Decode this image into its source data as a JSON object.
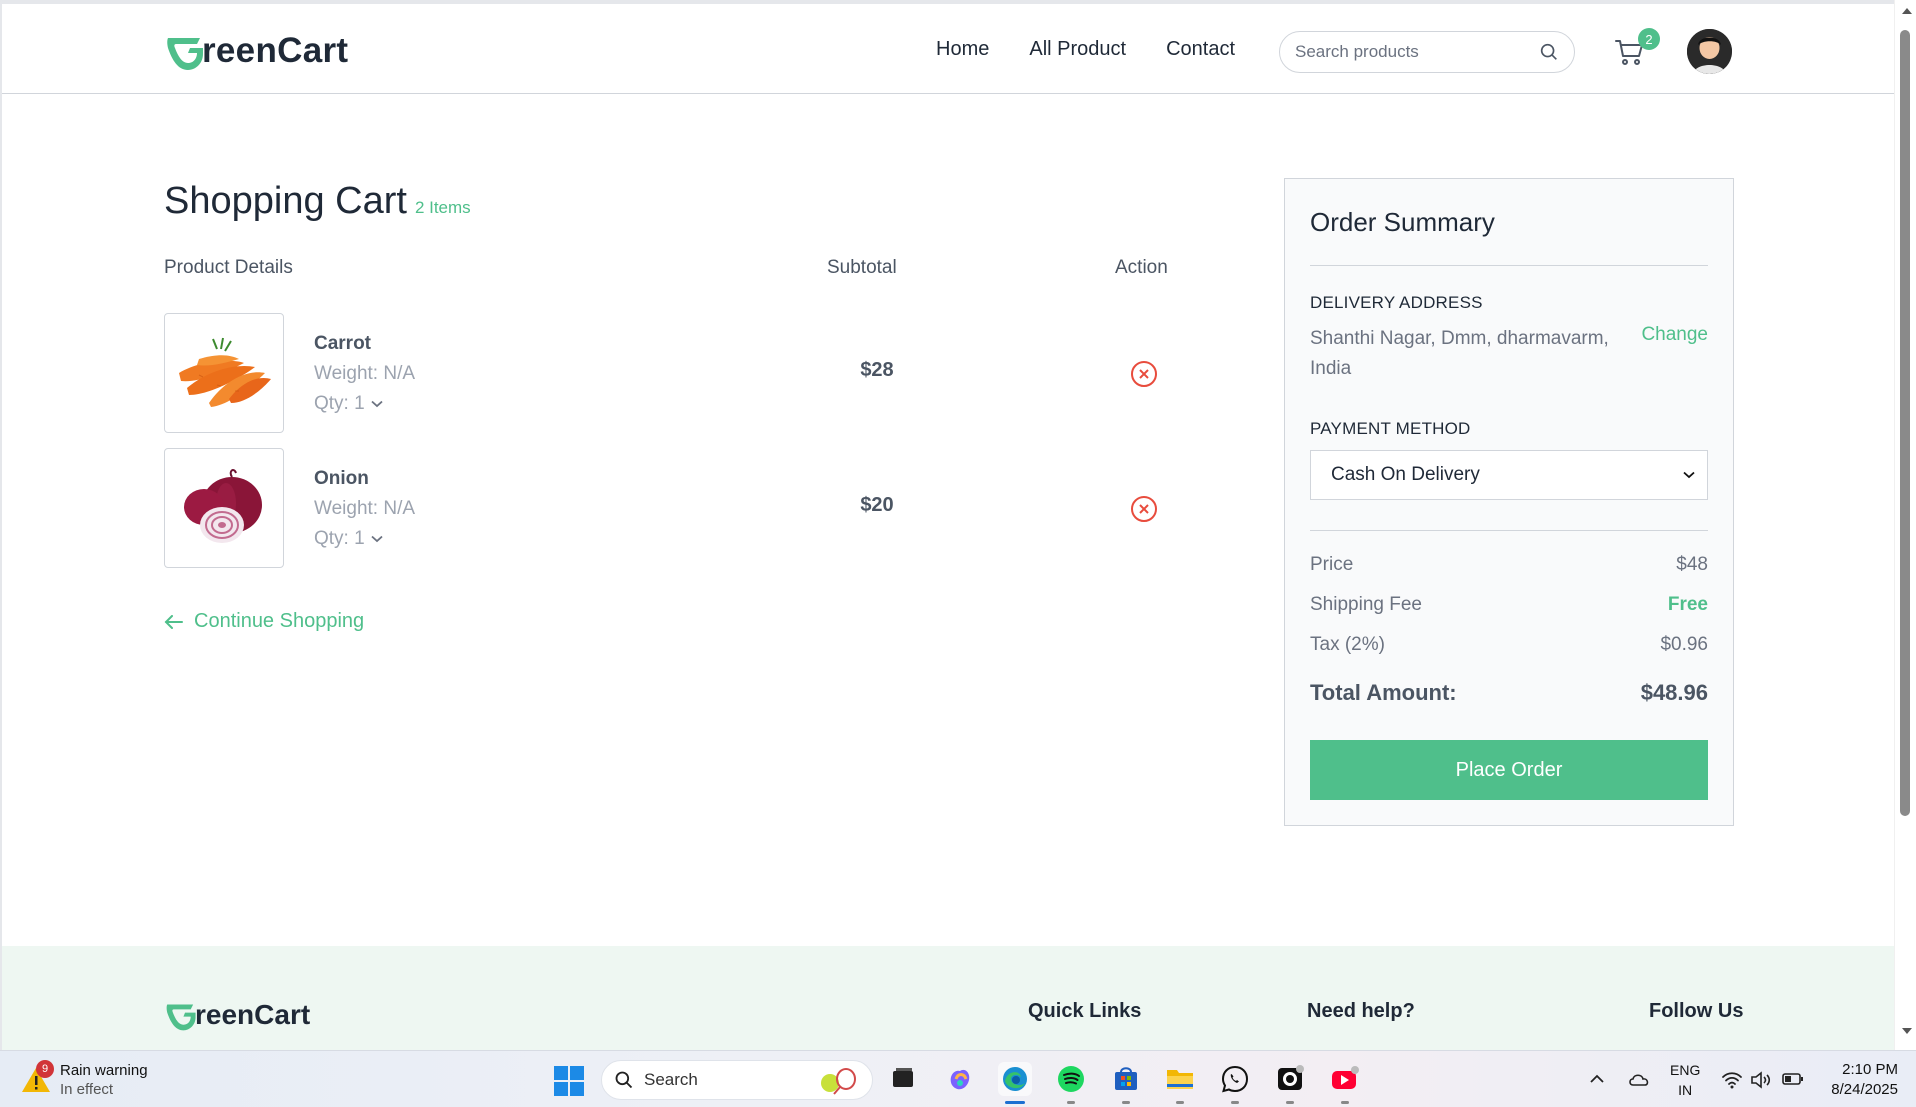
{
  "brand": {
    "name": "GreenCart",
    "logo_rest": "reenCart",
    "accent": "#4fbf8b"
  },
  "nav": {
    "links": [
      "Home",
      "All Product",
      "Contact"
    ],
    "search_placeholder": "Search products",
    "cart_count": "2"
  },
  "cart": {
    "title": "Shopping Cart",
    "item_count": "2 Items",
    "headers": {
      "product": "Product Details",
      "subtotal": "Subtotal",
      "action": "Action"
    },
    "items": [
      {
        "name": "Carrot",
        "weight": "Weight: N/A",
        "qty": "Qty: 1",
        "subtotal": "$28",
        "image_icon": "carrot-image"
      },
      {
        "name": "Onion",
        "weight": "Weight: N/A",
        "qty": "Qty: 1",
        "subtotal": "$20",
        "image_icon": "onion-image"
      }
    ],
    "continue_label": "Continue Shopping"
  },
  "summary": {
    "title": "Order Summary",
    "address_label": "DELIVERY ADDRESS",
    "address": "Shanthi Nagar, Dmm, dharmavarm, India",
    "change_label": "Change",
    "payment_label": "PAYMENT METHOD",
    "payment_selected": "Cash On Delivery",
    "price_label": "Price",
    "price_value": "$48",
    "shipping_label": "Shipping Fee",
    "shipping_value": "Free",
    "tax_label": "Tax (2%)",
    "tax_value": "$0.96",
    "total_label": "Total Amount:",
    "total_value": "$48.96",
    "place_order_label": "Place Order"
  },
  "footer": {
    "quick_links": "Quick Links",
    "need_help": "Need help?",
    "follow_us": "Follow Us"
  },
  "taskbar": {
    "weather_badge": "9",
    "weather_title": "Rain warning",
    "weather_sub": "In effect",
    "search_label": "Search",
    "lang_top": "ENG",
    "lang_bottom": "IN",
    "time": "2:10 PM",
    "date": "8/24/2025"
  }
}
